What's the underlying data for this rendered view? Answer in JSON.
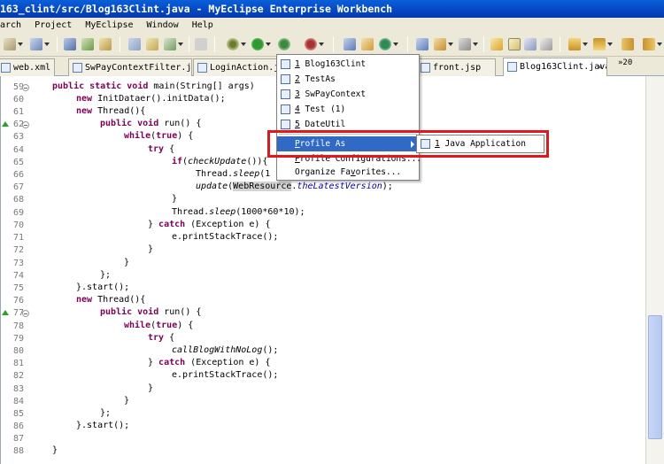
{
  "window": {
    "title": "163_clint/src/Blog163Clint.java - MyEclipse Enterprise Workbench"
  },
  "menubar": [
    "arch",
    "Project",
    "MyEclipse",
    "Window",
    "Help"
  ],
  "toolbar": {
    "icons": [
      "new-icon",
      "debug-icon",
      "run-icon",
      "run-config-icon",
      "profile-icon",
      "open-type-icon",
      "open-perspective-icon",
      "search-icon",
      "pin-icon",
      "prev-annotation-icon",
      "next-annotation-icon",
      "back-icon",
      "forward-icon"
    ]
  },
  "tabs": [
    {
      "label": "web.xml",
      "active": false
    },
    {
      "label": "SwPayContextFilter.j",
      "active": false
    },
    {
      "label": "LoginAction.jav",
      "active": false
    },
    {
      "label": "front.jsp",
      "active": false
    },
    {
      "label": "Blog163Clint.java",
      "active": true,
      "close": "×"
    }
  ],
  "tab_overflow": "»20",
  "gutter": {
    "line_numbers": [
      "59",
      "60",
      "61",
      "62",
      "63",
      "64",
      "65",
      "66",
      "67",
      "68",
      "69",
      "70",
      "71",
      "72",
      "73",
      "74",
      "75",
      "76",
      "77",
      "78",
      "79",
      "80",
      "81",
      "82",
      "83",
      "84",
      "85",
      "86",
      "87",
      "88"
    ]
  },
  "code": {
    "l59": [
      "public static void ",
      "main(String[] args)"
    ],
    "l60": [
      "new ",
      "InitDataer().initData();"
    ],
    "l61": [
      "new ",
      "Thread(){"
    ],
    "l62": [
      "public void ",
      "run() {"
    ],
    "l63": [
      "while",
      "(",
      "true",
      ") {"
    ],
    "l64": [
      "try",
      " {"
    ],
    "l65": [
      "if",
      "(",
      "checkUpdate",
      "()){"
    ],
    "l66": [
      "Thread.",
      "sleep",
      "(1"
    ],
    "l67": [
      "update",
      "(",
      "WebResource",
      ".",
      "theLatestVersion",
      ");"
    ],
    "l68": [
      "}"
    ],
    "l69": [
      "Thread.",
      "sleep",
      "(1000*60*10);"
    ],
    "l70": [
      "} ",
      "catch",
      " (Exception e) {"
    ],
    "l71": [
      "e.printStackTrace();"
    ],
    "l72": [
      "}"
    ],
    "l73": [
      "}"
    ],
    "l74": [
      "};"
    ],
    "l75": [
      "}.start();"
    ],
    "l76": [
      "new ",
      "Thread(){"
    ],
    "l77": [
      "public void ",
      "run() {"
    ],
    "l78": [
      "while",
      "(",
      "true",
      ") {"
    ],
    "l79": [
      "try",
      " {"
    ],
    "l80": [
      "callBlogWithNoLog",
      "();"
    ],
    "l81": [
      "} ",
      "catch",
      " (Exception e) {"
    ],
    "l82": [
      "e.printStackTrace();"
    ],
    "l83": [
      "}"
    ],
    "l84": [
      "}"
    ],
    "l85": [
      "};"
    ],
    "l86": [
      "}.start();"
    ],
    "l88": [
      "}"
    ]
  },
  "popup_menu": {
    "recent": [
      {
        "num": "1",
        "label": "Blog163Clint"
      },
      {
        "num": "2",
        "label": "TestAs"
      },
      {
        "num": "3",
        "label": "SwPayContext"
      },
      {
        "num": "4",
        "label": "Test (1)"
      },
      {
        "num": "5",
        "label": "DateUtil"
      }
    ],
    "profile_as": {
      "mnemonic": "P",
      "label": "rofile As"
    },
    "profile_configurations": {
      "mnemonic": "P",
      "label": "rofile Configurations..."
    },
    "organize_favorites": {
      "pre": "Organize Fa",
      "mnemonic": "v",
      "post": "orites..."
    }
  },
  "submenu": {
    "num": "1",
    "label": "Java Application"
  },
  "colors": {
    "titlebar": "#0546c4",
    "highlight": "#316ac5",
    "keyword": "#7f0055",
    "field": "#0000c0",
    "annotation_box": "#e2161f"
  }
}
